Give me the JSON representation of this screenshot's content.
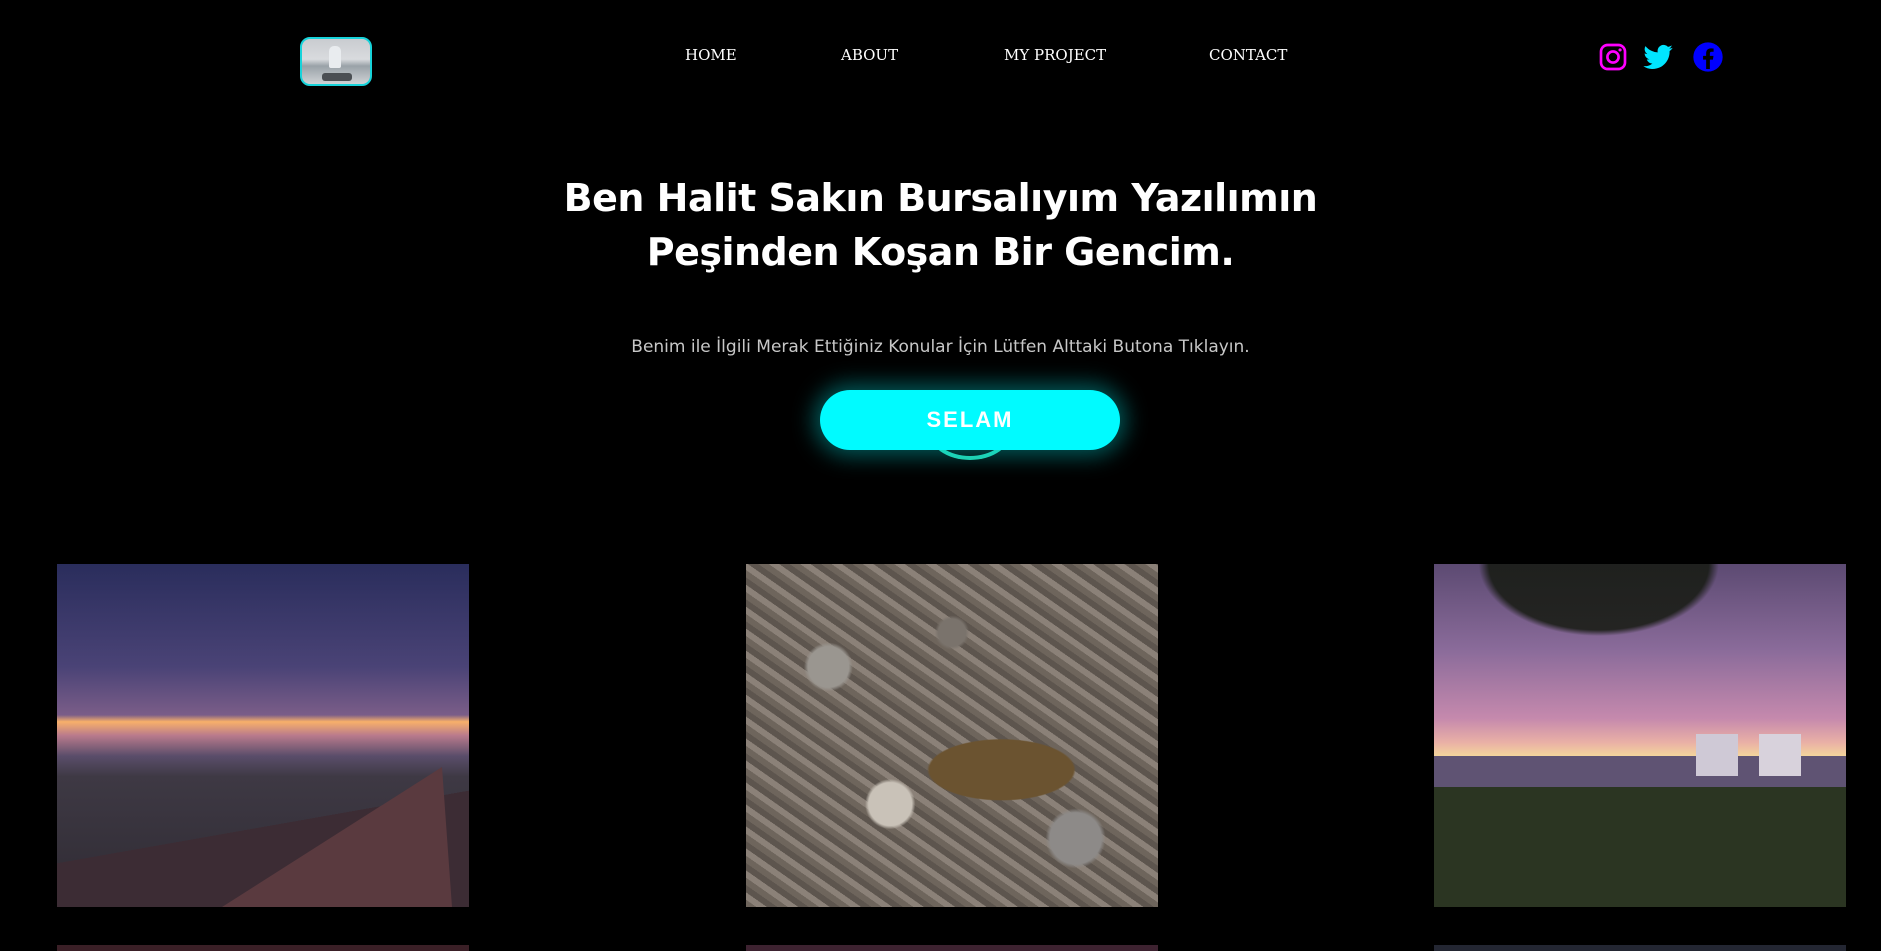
{
  "header": {
    "logo_alt": "profile photo",
    "nav": [
      {
        "label": "HOME"
      },
      {
        "label": "ABOUT"
      },
      {
        "label": "MY PROJECT"
      },
      {
        "label": "CONTACT"
      }
    ],
    "social": [
      {
        "icon": "instagram-icon",
        "color": "#ff00ff"
      },
      {
        "icon": "twitter-icon",
        "color": "#00e5ff"
      },
      {
        "icon": "facebook-icon",
        "color": "#0000ff"
      }
    ]
  },
  "hero": {
    "title_line1": "Ben Halit Sakın Bursalıyım Yazılımın",
    "title_line2": "Peşinden Koşan Bir Gencim.",
    "subtitle": "Benim ile İlgili Merak Ettiğiniz Konular İçin Lütfen Alttaki Butona Tıklayın.",
    "button_label": "SELAM",
    "accent": "#00fbff"
  },
  "gallery": {
    "photos": [
      {
        "name": "sunset-road-photo"
      },
      {
        "name": "tortoise-photo"
      },
      {
        "name": "lakeside-sunset-photo"
      }
    ]
  }
}
